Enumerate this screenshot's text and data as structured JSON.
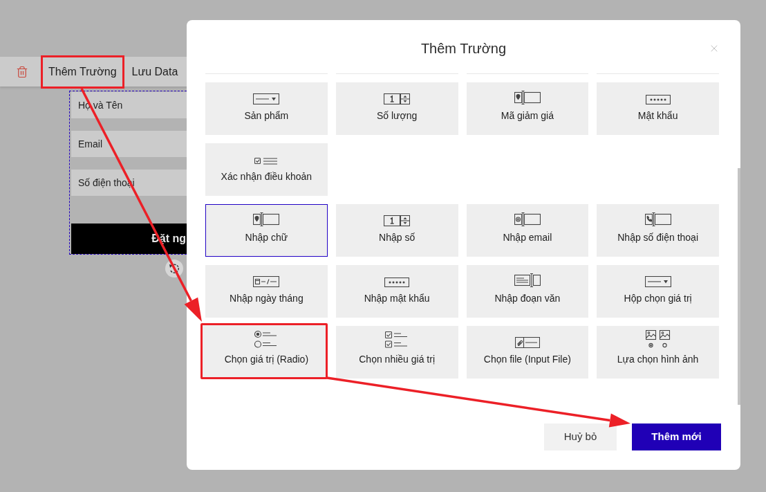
{
  "toolbar": {
    "items": [
      {
        "kind": "delete",
        "highlighted": false
      },
      {
        "kind": "text",
        "label": "Thêm Trường",
        "highlighted": true
      },
      {
        "kind": "text",
        "label": "Lưu Data",
        "highlighted": false
      }
    ]
  },
  "form_preview": {
    "fields": [
      {
        "placeholder": "Họ và Tên"
      },
      {
        "placeholder": "Email"
      },
      {
        "placeholder": "Số điện thoại"
      }
    ],
    "submit_button": "Đặt ng"
  },
  "dialog": {
    "title": "Thêm Trường",
    "groups": [
      {
        "items": [
          {
            "kind": "select",
            "label": "Sản phẩm",
            "selected": false,
            "highlighted": false
          },
          {
            "kind": "number",
            "label": "Số lượng",
            "selected": false,
            "highlighted": false
          },
          {
            "kind": "text",
            "label": "Mã giảm giá",
            "selected": false,
            "highlighted": false
          },
          {
            "kind": "password",
            "label": "Mật khẩu",
            "selected": false,
            "highlighted": false
          },
          {
            "kind": "terms",
            "label": "Xác nhận điều khoản",
            "selected": false,
            "highlighted": false
          }
        ]
      },
      {
        "items": [
          {
            "kind": "text",
            "label": "Nhập chữ",
            "selected": true,
            "highlighted": false
          },
          {
            "kind": "number",
            "label": "Nhập số",
            "selected": false,
            "highlighted": false
          },
          {
            "kind": "email",
            "label": "Nhập email",
            "selected": false,
            "highlighted": false
          },
          {
            "kind": "phone",
            "label": "Nhập số điện thoại",
            "selected": false,
            "highlighted": false
          },
          {
            "kind": "date",
            "label": "Nhập ngày tháng",
            "selected": false,
            "highlighted": false
          },
          {
            "kind": "password",
            "label": "Nhập mật khẩu",
            "selected": false,
            "highlighted": false
          },
          {
            "kind": "textarea",
            "label": "Nhập đoạn văn",
            "selected": false,
            "highlighted": false
          },
          {
            "kind": "select",
            "label": "Hộp chọn giá trị",
            "selected": false,
            "highlighted": false
          },
          {
            "kind": "radio",
            "label": "Chọn giá trị (Radio)",
            "selected": false,
            "highlighted": true
          },
          {
            "kind": "checkbox",
            "label": "Chọn nhiều giá trị",
            "selected": false,
            "highlighted": false
          },
          {
            "kind": "file",
            "label": "Chọn file (Input File)",
            "selected": false,
            "highlighted": false
          },
          {
            "kind": "image",
            "label": "Lựa chọn hình ảnh",
            "selected": false,
            "highlighted": false
          }
        ]
      }
    ],
    "buttons": [
      {
        "kind": "secondary",
        "label": "Huỷ bỏ"
      },
      {
        "kind": "primary",
        "label": "Thêm mới"
      }
    ]
  }
}
